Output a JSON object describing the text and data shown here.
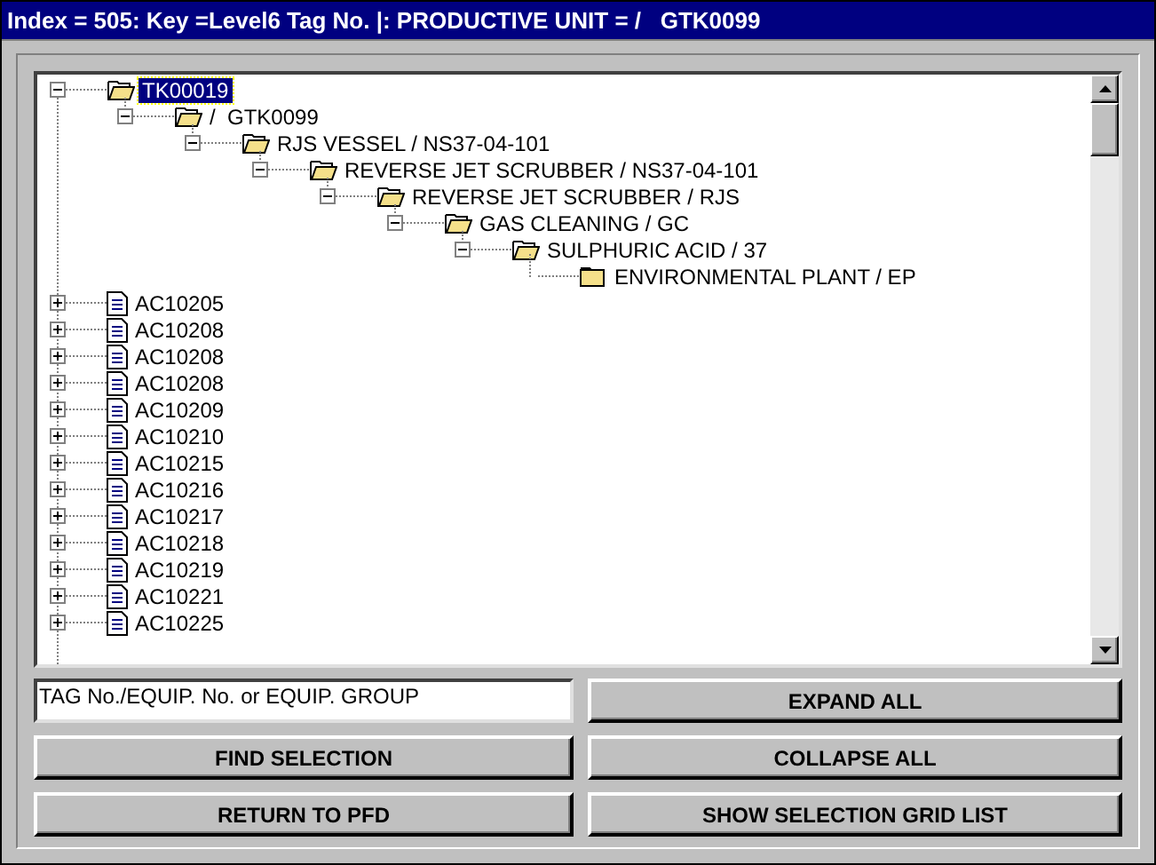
{
  "window": {
    "title": "Index = 505: Key =Level6 Tag No. |: PRODUCTIVE UNIT = /   GTK0099"
  },
  "tree": [
    {
      "label": "TK00019",
      "kind": "folder",
      "expanded": true,
      "selected": true,
      "children": [
        {
          "label": "/  GTK0099",
          "kind": "folder",
          "expanded": true,
          "selected": false,
          "children": [
            {
              "label": "RJS VESSEL / NS37-04-101",
              "kind": "folder",
              "expanded": true,
              "selected": false,
              "children": [
                {
                  "label": "REVERSE JET SCRUBBER / NS37-04-101",
                  "kind": "folder",
                  "expanded": true,
                  "selected": false,
                  "children": [
                    {
                      "label": "REVERSE JET SCRUBBER / RJS",
                      "kind": "folder",
                      "expanded": true,
                      "selected": false,
                      "children": [
                        {
                          "label": "GAS CLEANING / GC",
                          "kind": "folder",
                          "expanded": true,
                          "selected": false,
                          "children": [
                            {
                              "label": "SULPHURIC ACID / 37",
                              "kind": "folder",
                              "expanded": true,
                              "selected": false,
                              "children": [
                                {
                                  "label": "ENVIRONMENTAL PLANT / EP",
                                  "kind": "folder",
                                  "selected": false
                                }
                              ]
                            }
                          ]
                        }
                      ]
                    }
                  ]
                }
              ]
            }
          ]
        }
      ]
    },
    {
      "label": "AC10205",
      "kind": "document",
      "expanded": false,
      "selected": false
    },
    {
      "label": "AC10208",
      "kind": "document",
      "expanded": false,
      "selected": false
    },
    {
      "label": "AC10208",
      "kind": "document",
      "expanded": false,
      "selected": false
    },
    {
      "label": "AC10208",
      "kind": "document",
      "expanded": false,
      "selected": false
    },
    {
      "label": "AC10209",
      "kind": "document",
      "expanded": false,
      "selected": false
    },
    {
      "label": "AC10210",
      "kind": "document",
      "expanded": false,
      "selected": false
    },
    {
      "label": "AC10215",
      "kind": "document",
      "expanded": false,
      "selected": false
    },
    {
      "label": "AC10216",
      "kind": "document",
      "expanded": false,
      "selected": false
    },
    {
      "label": "AC10217",
      "kind": "document",
      "expanded": false,
      "selected": false
    },
    {
      "label": "AC10218",
      "kind": "document",
      "expanded": false,
      "selected": false
    },
    {
      "label": "AC10219",
      "kind": "document",
      "expanded": false,
      "selected": false
    },
    {
      "label": "AC10221",
      "kind": "document",
      "expanded": false,
      "selected": false
    },
    {
      "label": "AC10225",
      "kind": "document",
      "expanded": false,
      "selected": false
    }
  ],
  "search_field": {
    "value": "TAG No./EQUIP. No. or EQUIP. GROUP"
  },
  "buttons": {
    "expand_all": "EXPAND ALL",
    "find_selection": "FIND SELECTION",
    "collapse_all": "COLLAPSE ALL",
    "return_to_pfd": "RETURN TO PFD",
    "show_selection_grid_list": "SHOW SELECTION GRID LIST"
  }
}
